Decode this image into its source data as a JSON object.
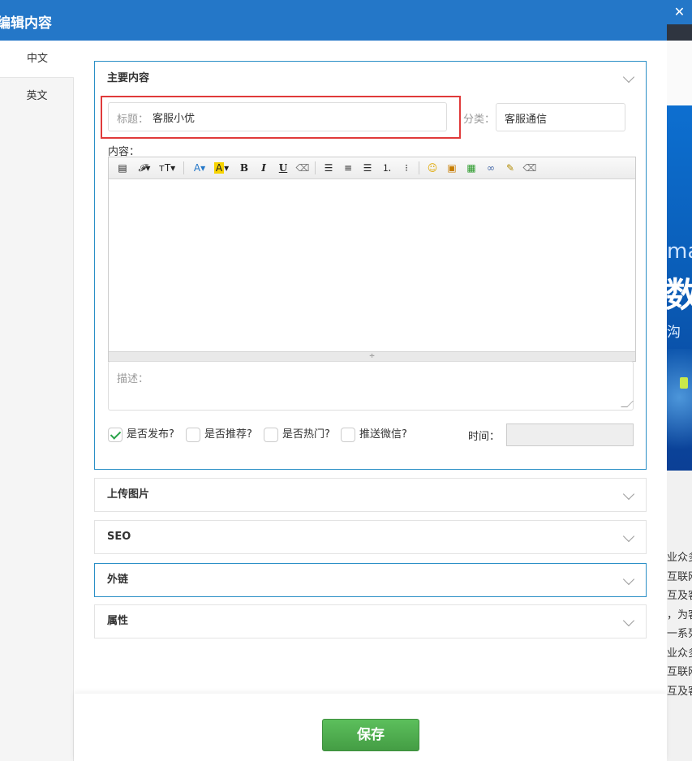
{
  "modal": {
    "title": "编辑内容"
  },
  "tabs": [
    {
      "label": "中文"
    },
    {
      "label": "英文"
    }
  ],
  "panels": {
    "main": {
      "title": "主要内容"
    },
    "upload": {
      "title": "上传图片"
    },
    "seo": {
      "title": "SEO"
    },
    "links": {
      "title": "外链"
    },
    "attrs": {
      "title": "属性"
    }
  },
  "form": {
    "title_label": "标题：",
    "title_value": "客服小优",
    "category_label": "分类：",
    "category_value": "客服通信",
    "content_label": "内容：",
    "description_placeholder": "描述：",
    "checkboxes": [
      {
        "label": "是否发布?",
        "checked": true
      },
      {
        "label": "是否推荐?",
        "checked": false
      },
      {
        "label": "是否热门?",
        "checked": false
      },
      {
        "label": "推送微信?",
        "checked": false
      }
    ],
    "time_label": "时间："
  },
  "toolbar_icons": [
    "source-icon",
    "font-family-icon",
    "font-size-icon",
    "font-color-icon",
    "bg-color-icon",
    "bold-icon",
    "italic-icon",
    "underline-icon",
    "clear-format-icon",
    "align-left-icon",
    "align-center-icon",
    "align-right-icon",
    "ordered-list-icon",
    "unordered-list-icon",
    "emoticon-icon",
    "insert-image-icon",
    "insert-media-icon",
    "link-icon",
    "paste-word-icon",
    "eraser-icon"
  ],
  "footer": {
    "save_label": "保存"
  },
  "background": {
    "banner_text_1": "ma",
    "banner_text_2": "数",
    "banner_text_3": "沟",
    "text_lines": [
      "业众多",
      "互联网",
      "互及客",
      "，为客",
      "一系列",
      "业众多",
      "互联网",
      "互及客"
    ]
  },
  "colors": {
    "header": "#2477c8",
    "active_panel_border": "#2a8fc6",
    "save_button": "#4cae4c",
    "highlight_box": "#e03a3a"
  }
}
